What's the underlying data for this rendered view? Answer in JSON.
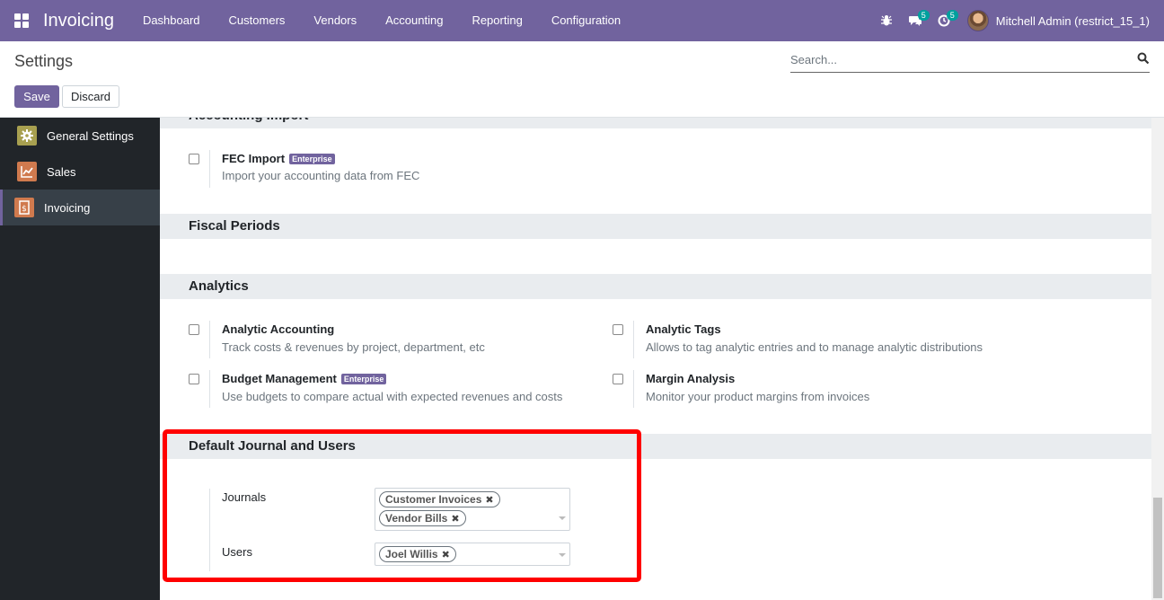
{
  "app": {
    "brand": "Invoicing"
  },
  "navbar": {
    "menu": [
      "Dashboard",
      "Customers",
      "Vendors",
      "Accounting",
      "Reporting",
      "Configuration"
    ],
    "messages_count": "5",
    "activities_count": "5",
    "user_name": "Mitchell Admin (restrict_15_1)",
    "accent_color": "#71639e"
  },
  "control_panel": {
    "title": "Settings",
    "search_placeholder": "Search...",
    "save_label": "Save",
    "discard_label": "Discard"
  },
  "sidebar": {
    "items": [
      {
        "label": "General Settings",
        "icon": "gear-icon",
        "color": "#a8a050"
      },
      {
        "label": "Sales",
        "icon": "chart-icon",
        "color": "#d07a4e"
      },
      {
        "label": "Invoicing",
        "icon": "invoice-icon",
        "color": "#d07a4e",
        "active": true
      }
    ]
  },
  "sections": {
    "accounting_import": {
      "title": "Accounting Import",
      "fec_label": "FEC Import",
      "fec_badge": "Enterprise",
      "fec_desc": "Import your accounting data from FEC"
    },
    "fiscal_periods": {
      "title": "Fiscal Periods"
    },
    "analytics": {
      "title": "Analytics",
      "analytic_accounting_label": "Analytic Accounting",
      "analytic_accounting_desc": "Track costs & revenues by project, department, etc",
      "analytic_tags_label": "Analytic Tags",
      "analytic_tags_desc": "Allows to tag analytic entries and to manage analytic distributions",
      "budget_label": "Budget Management",
      "budget_badge": "Enterprise",
      "budget_desc": "Use budgets to compare actual with expected revenues and costs",
      "margin_label": "Margin Analysis",
      "margin_desc": "Monitor your product margins from invoices"
    },
    "default_journal": {
      "title": "Default Journal and Users",
      "journals_label": "Journals",
      "journals_tags": [
        "Customer Invoices",
        "Vendor Bills"
      ],
      "users_label": "Users",
      "users_tags": [
        "Joel Willis"
      ]
    }
  }
}
